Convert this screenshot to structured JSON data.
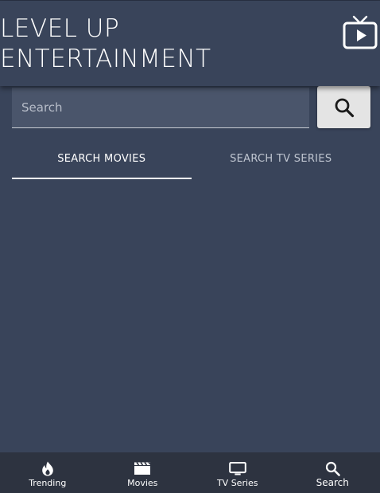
{
  "header": {
    "title": "LEVEL UP\nENTERTAINMENT",
    "logo_icon": "tv-play-icon"
  },
  "search": {
    "placeholder": "Search",
    "value": "",
    "button_icon": "search-icon"
  },
  "tabs": [
    {
      "label": "SEARCH MOVIES",
      "active": true
    },
    {
      "label": "SEARCH TV SERIES",
      "active": false
    }
  ],
  "bottom_nav": [
    {
      "label": "Trending",
      "icon": "flame-icon",
      "active": false
    },
    {
      "label": "Movies",
      "icon": "clapperboard-icon",
      "active": false
    },
    {
      "label": "TV Series",
      "icon": "tv-icon",
      "active": false
    },
    {
      "label": "Search",
      "icon": "search-icon",
      "active": true
    }
  ],
  "colors": {
    "background": "#39445a",
    "nav_background": "#2d3340",
    "search_field": "#4a556b",
    "search_button": "#e4e4e4",
    "text": "#ffffff"
  }
}
